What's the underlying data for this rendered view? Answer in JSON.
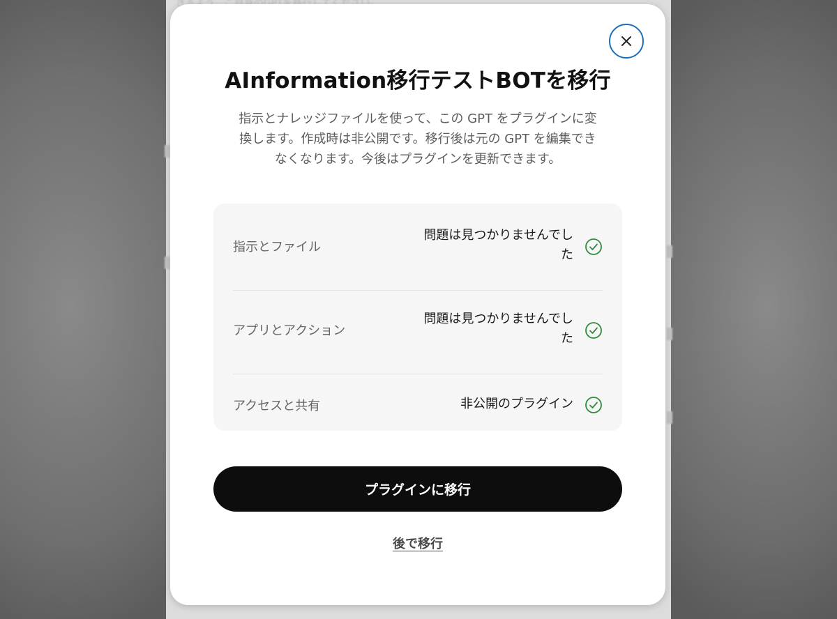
{
  "background": {
    "partial_text": "きるよう、ご自身のGPTを移行してください。"
  },
  "modal": {
    "title": "AInformation移行テストBOTを移行",
    "description_lines": [
      "指示とナレッジファイルを使って、この GPT をプラグインに変",
      "換します。作成時は非公開です。移行後は元の GPT を編集でき",
      "なくなります。今後はプラグインを更新できます。"
    ],
    "checks": [
      {
        "label": "指示とファイル",
        "status_lines": [
          "問題は見つかりませんでし",
          "た"
        ],
        "icon": "check-circle-icon"
      },
      {
        "label": "アプリとアクション",
        "status_lines": [
          "問題は見つかりませんでし",
          "た"
        ],
        "icon": "check-circle-icon"
      },
      {
        "label": "アクセスと共有",
        "status_lines": [
          "非公開のプラグイン"
        ],
        "icon": "check-circle-icon"
      }
    ],
    "primary_button": "プラグインに移行",
    "secondary_link": "後で移行",
    "close_icon": "close-icon"
  },
  "colors": {
    "check_green": "#2e8b3a",
    "close_border": "#1f6fb8",
    "primary_button_bg": "#0d0d0d"
  }
}
